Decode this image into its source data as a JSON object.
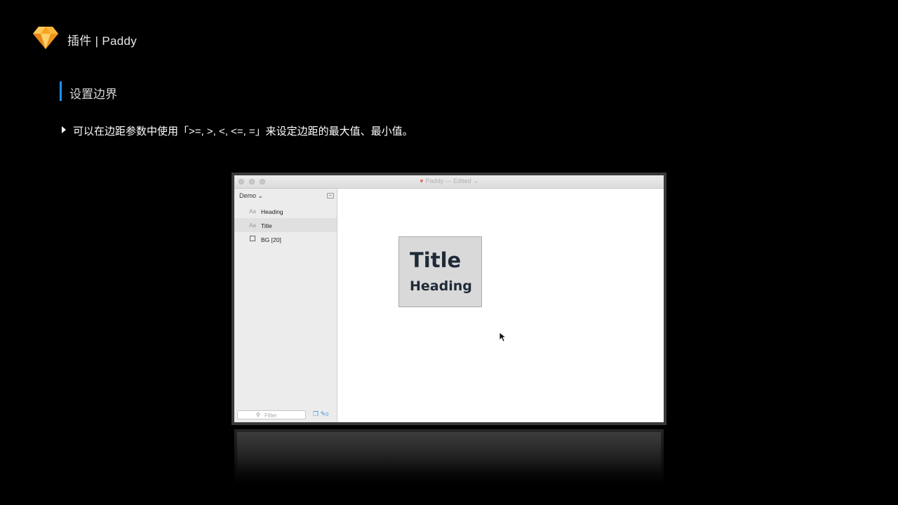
{
  "header": {
    "title": "插件 | Paddy"
  },
  "section": {
    "title": "设置边界"
  },
  "bullet": {
    "text": "可以在边距参数中使用「>=, >, <, <=, =」来设定边距的最大值、最小值。"
  },
  "app_window": {
    "title": "Paddy",
    "edited_label": "— Edited",
    "sidebar": {
      "page_selector": "Demo ⌄",
      "layers": [
        {
          "icon": "Aa",
          "label": "Heading",
          "type": "text"
        },
        {
          "icon": "Aa",
          "label": "Title",
          "type": "text"
        },
        {
          "icon": "",
          "label": "BG [20]",
          "type": "shape"
        }
      ],
      "filter_placeholder": "Filter",
      "tools_count": "0"
    },
    "artboard": {
      "title_text": "Title",
      "heading_text": "Heading"
    }
  },
  "colors": {
    "accent": "#1e8ff0",
    "background": "#000000",
    "logo": "#f7a21b"
  },
  "icons": {
    "logo": "sketch-diamond-icon",
    "bullet": "triangle-right-icon",
    "search": "search-icon",
    "cursor": "mouse-pointer-icon"
  }
}
